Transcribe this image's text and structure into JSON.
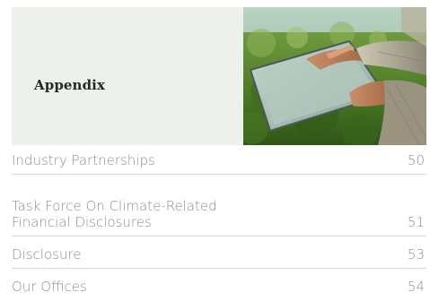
{
  "section": {
    "title": "Appendix"
  },
  "toc": [
    {
      "label": "Industry Partnerships",
      "page": "50"
    },
    {
      "label_lines": [
        "Task Force On Climate-Related",
        "Financial Disclosures"
      ],
      "page": "51"
    },
    {
      "label": "Disclosure",
      "page": "53"
    },
    {
      "label": "Our Offices",
      "page": "54"
    }
  ]
}
